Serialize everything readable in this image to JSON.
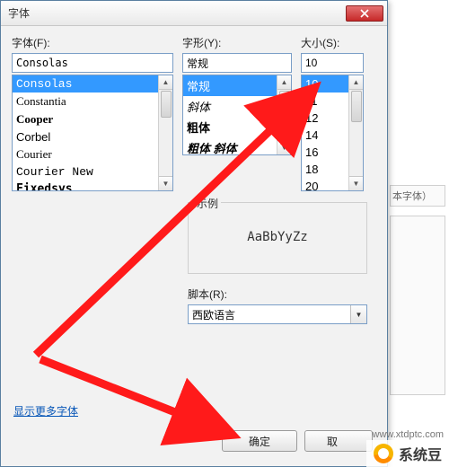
{
  "dialog": {
    "title": "字体",
    "font": {
      "label": "字体(F):",
      "value": "Consolas",
      "items": [
        "Consolas",
        "Constantia",
        "Cooper",
        "Corbel",
        "Courier",
        "Courier New",
        "Fixedsys"
      ],
      "selected_index": 0
    },
    "style": {
      "label": "字形(Y):",
      "value": "常规",
      "items": [
        "常规",
        "斜体",
        "粗体",
        "粗体 斜体"
      ],
      "selected_index": 0
    },
    "size": {
      "label": "大小(S):",
      "value": "10",
      "items": [
        "10",
        "11",
        "12",
        "14",
        "16",
        "18",
        "20"
      ],
      "selected_index": 0
    },
    "sample": {
      "label": "示例",
      "text": "AaBbYyZz"
    },
    "script": {
      "label": "脚本(R):",
      "value": "西欧语言"
    },
    "link": "显示更多字体",
    "ok": "确定",
    "cancel_prefix": "取"
  },
  "bg": {
    "slot_a_text": "本字体）"
  },
  "watermark": {
    "brand": "系统豆",
    "url": "www.xtdptc.com"
  }
}
